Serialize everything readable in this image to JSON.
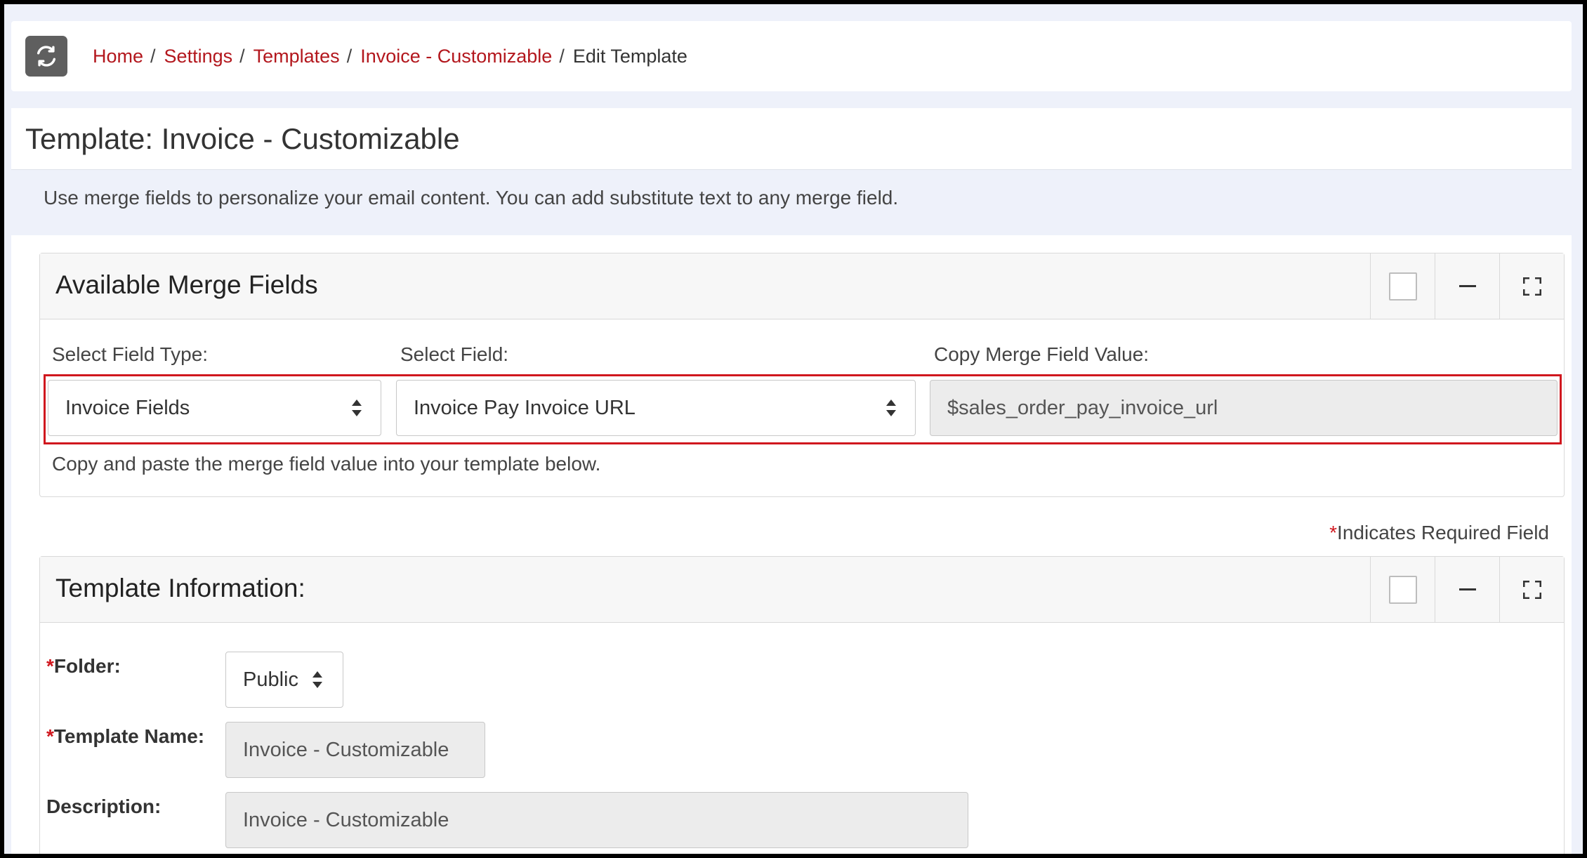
{
  "breadcrumb": {
    "items": [
      "Home",
      "Settings",
      "Templates",
      "Invoice - Customizable"
    ],
    "separator": "/",
    "current": "Edit Template"
  },
  "page": {
    "title": "Template: Invoice - Customizable",
    "info": "Use merge fields to personalize your email content. You can add substitute text to any merge field."
  },
  "merge_panel": {
    "title": "Available Merge Fields",
    "field_type_label": "Select Field Type:",
    "field_type_value": "Invoice Fields",
    "field_label": "Select Field:",
    "field_value": "Invoice Pay Invoice URL",
    "copy_label": "Copy Merge Field Value:",
    "copy_value": "$sales_order_pay_invoice_url",
    "help": "Copy and paste the merge field value into your template below."
  },
  "required_note": {
    "star": "*",
    "text": "Indicates Required Field"
  },
  "template_panel": {
    "title": "Template Information:",
    "folder_label": "Folder:",
    "folder_value": "Public",
    "name_label": "Template Name:",
    "name_value": "Invoice - Customizable",
    "description_label": "Description:",
    "description_value": "Invoice - Customizable"
  },
  "colors": {
    "link": "#b3171d",
    "highlight": "#d0171e",
    "refresh_button": "#5f5f5f",
    "page_background": "#eef1fa"
  },
  "icons": {
    "refresh": "refresh-icon",
    "select_arrows": "sort-arrows-icon",
    "expand": "expand-icon",
    "minimize": "minus-icon"
  }
}
